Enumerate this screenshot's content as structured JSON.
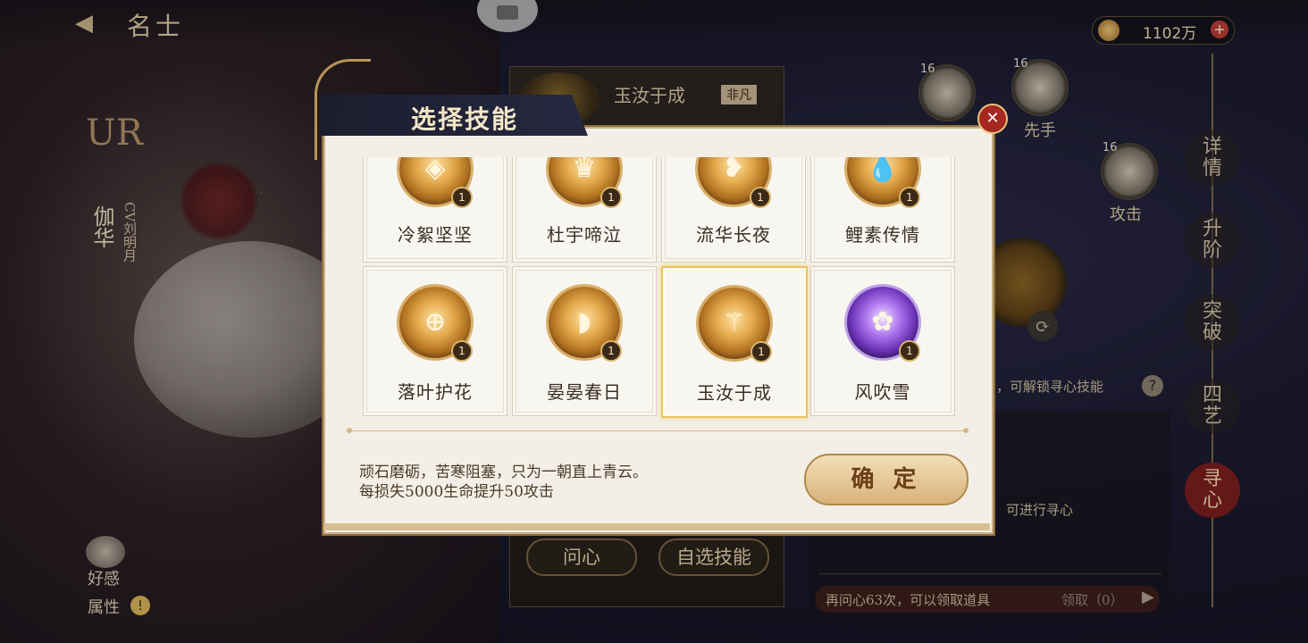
{
  "header": {
    "title": "名士",
    "back_icon": "back-arrow-icon",
    "camera_icon": "camera-icon",
    "currency": {
      "amount": "1102万",
      "icon": "coin-icon",
      "add_icon": "plus-icon"
    }
  },
  "character": {
    "rarity": "UR",
    "name": "伽华",
    "cv": "CV刘明月",
    "affection_label": "好感",
    "attribute_label": "属性"
  },
  "mid_panel": {
    "skill_name": "玉汝于成",
    "skill_tag": "非凡",
    "buttons": [
      "问心",
      "自选技能"
    ]
  },
  "right_area": {
    "slot_level": "16",
    "slot_labels": [
      "先手",
      "攻击"
    ],
    "unlock_text": "后，可解锁寻心技能",
    "seek_hint": "可进行寻心",
    "bottom_text": "再问心63次，可以领取道具",
    "claim_text": "领取（0）"
  },
  "nav": {
    "items": [
      "详情",
      "升阶",
      "突破",
      "四艺",
      "寻心"
    ],
    "active": "寻心"
  },
  "dialog": {
    "title": "选择技能",
    "close_icon": "close-icon",
    "skills": [
      {
        "name": "冷絮坚坚",
        "badge": "1",
        "icon": "shield-icon",
        "glyph": "◈",
        "theme": "gold"
      },
      {
        "name": "杜宇啼泣",
        "badge": "1",
        "icon": "crown-shield-icon",
        "glyph": "♛",
        "theme": "gold"
      },
      {
        "name": "流华长夜",
        "badge": "1",
        "icon": "swirl-heart-icon",
        "glyph": "❥",
        "theme": "gold"
      },
      {
        "name": "鲤素传情",
        "badge": "1",
        "icon": "droplet-icon",
        "glyph": "💧",
        "theme": "gold"
      },
      {
        "name": "落叶护花",
        "badge": "1",
        "icon": "crosshair-icon",
        "glyph": "⊕",
        "theme": "gold"
      },
      {
        "name": "晏晏春日",
        "badge": "1",
        "icon": "boot-icon",
        "glyph": "◗",
        "theme": "gold"
      },
      {
        "name": "玉汝于成",
        "badge": "1",
        "icon": "trident-icon",
        "glyph": "⚚",
        "theme": "gold",
        "selected": true
      },
      {
        "name": "风吹雪",
        "badge": "1",
        "icon": "lotus-heart-icon",
        "glyph": "✿",
        "theme": "purple"
      }
    ],
    "description": {
      "line1": "顽石磨砺，苦寒阻塞，只为一朝直上青云。",
      "line2": "每损失5000生命提升50攻击"
    },
    "confirm_label": "确 定"
  }
}
